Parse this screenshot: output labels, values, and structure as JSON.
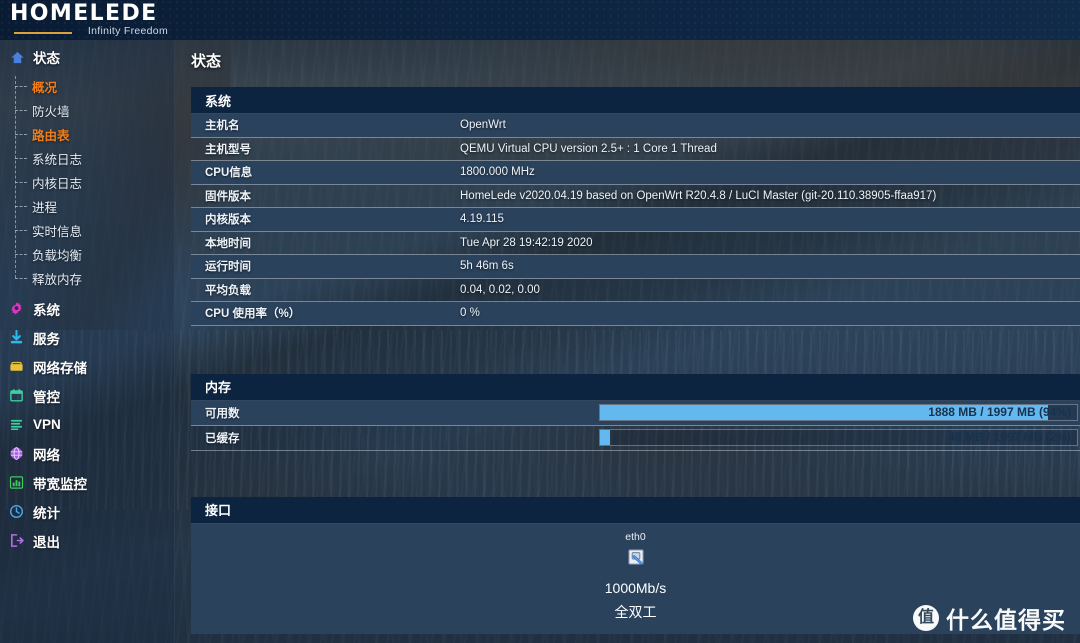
{
  "brand": {
    "name": "HOMELEDE",
    "tagline": "Infinity Freedom"
  },
  "page": {
    "title": "状态"
  },
  "sidebar": {
    "status_group": {
      "label": "状态",
      "icon": "home-icon",
      "items": [
        {
          "label": "概况",
          "active": true
        },
        {
          "label": "防火墙",
          "active": false
        },
        {
          "label": "路由表",
          "active": true
        },
        {
          "label": "系统日志",
          "active": false
        },
        {
          "label": "内核日志",
          "active": false
        },
        {
          "label": "进程",
          "active": false
        },
        {
          "label": "实时信息",
          "active": false
        },
        {
          "label": "负载均衡",
          "active": false
        },
        {
          "label": "释放内存",
          "active": false
        }
      ]
    },
    "items": [
      {
        "label": "系统",
        "icon": "gear-icon",
        "color": "#e033c0"
      },
      {
        "label": "服务",
        "icon": "download-icon",
        "color": "#2fb7e8"
      },
      {
        "label": "网络存储",
        "icon": "folder-icon",
        "color": "#e8c23a"
      },
      {
        "label": "管控",
        "icon": "calendar-icon",
        "color": "#3ecfa0"
      },
      {
        "label": "VPN",
        "icon": "list-icon",
        "color": "#3ecfa0"
      },
      {
        "label": "网络",
        "icon": "globe-icon",
        "color": "#a45ce0"
      },
      {
        "label": "带宽监控",
        "icon": "bar-chart-icon",
        "color": "#3ec95e"
      },
      {
        "label": "统计",
        "icon": "clock-icon",
        "color": "#4aa8e8"
      },
      {
        "label": "退出",
        "icon": "logout-icon",
        "color": "#b46ce8"
      }
    ]
  },
  "system_panel": {
    "title": "系统",
    "rows": [
      {
        "key": "主机名",
        "value": "OpenWrt"
      },
      {
        "key": "主机型号",
        "value": "QEMU Virtual CPU version 2.5+ : 1 Core 1 Thread"
      },
      {
        "key": "CPU信息",
        "value": "1800.000 MHz"
      },
      {
        "key": "固件版本",
        "value": "HomeLede v2020.04.19 based on OpenWrt R20.4.8 / LuCI Master (git-20.110.38905-ffaa917)"
      },
      {
        "key": "内核版本",
        "value": "4.19.115"
      },
      {
        "key": "本地时间",
        "value": "Tue Apr 28 19:42:19 2020"
      },
      {
        "key": "运行时间",
        "value": "5h 46m 6s"
      },
      {
        "key": "平均负载",
        "value": "0.04, 0.02, 0.00"
      },
      {
        "key": "CPU 使用率（%）",
        "value": "0 %"
      }
    ]
  },
  "memory_panel": {
    "title": "内存",
    "rows": [
      {
        "key": "可用数",
        "text": "1888 MB / 1997 MB (94%)",
        "percent": 94
      },
      {
        "key": "已缓存",
        "text": "48 MB / 1997 MB (2%)",
        "percent": 2
      }
    ]
  },
  "interface_panel": {
    "title": "接口",
    "iface": {
      "name": "eth0",
      "icon": "ethernet-port-icon",
      "speed": "1000Mb/s",
      "duplex": "全双工"
    }
  },
  "watermark": {
    "badge": "值",
    "text": "什么值得买"
  },
  "colors": {
    "accent_orange": "#f07d1a",
    "panel_header": "#0d2440",
    "row_opaque": "#2b425c",
    "bar_fill": "#63b8f0"
  }
}
